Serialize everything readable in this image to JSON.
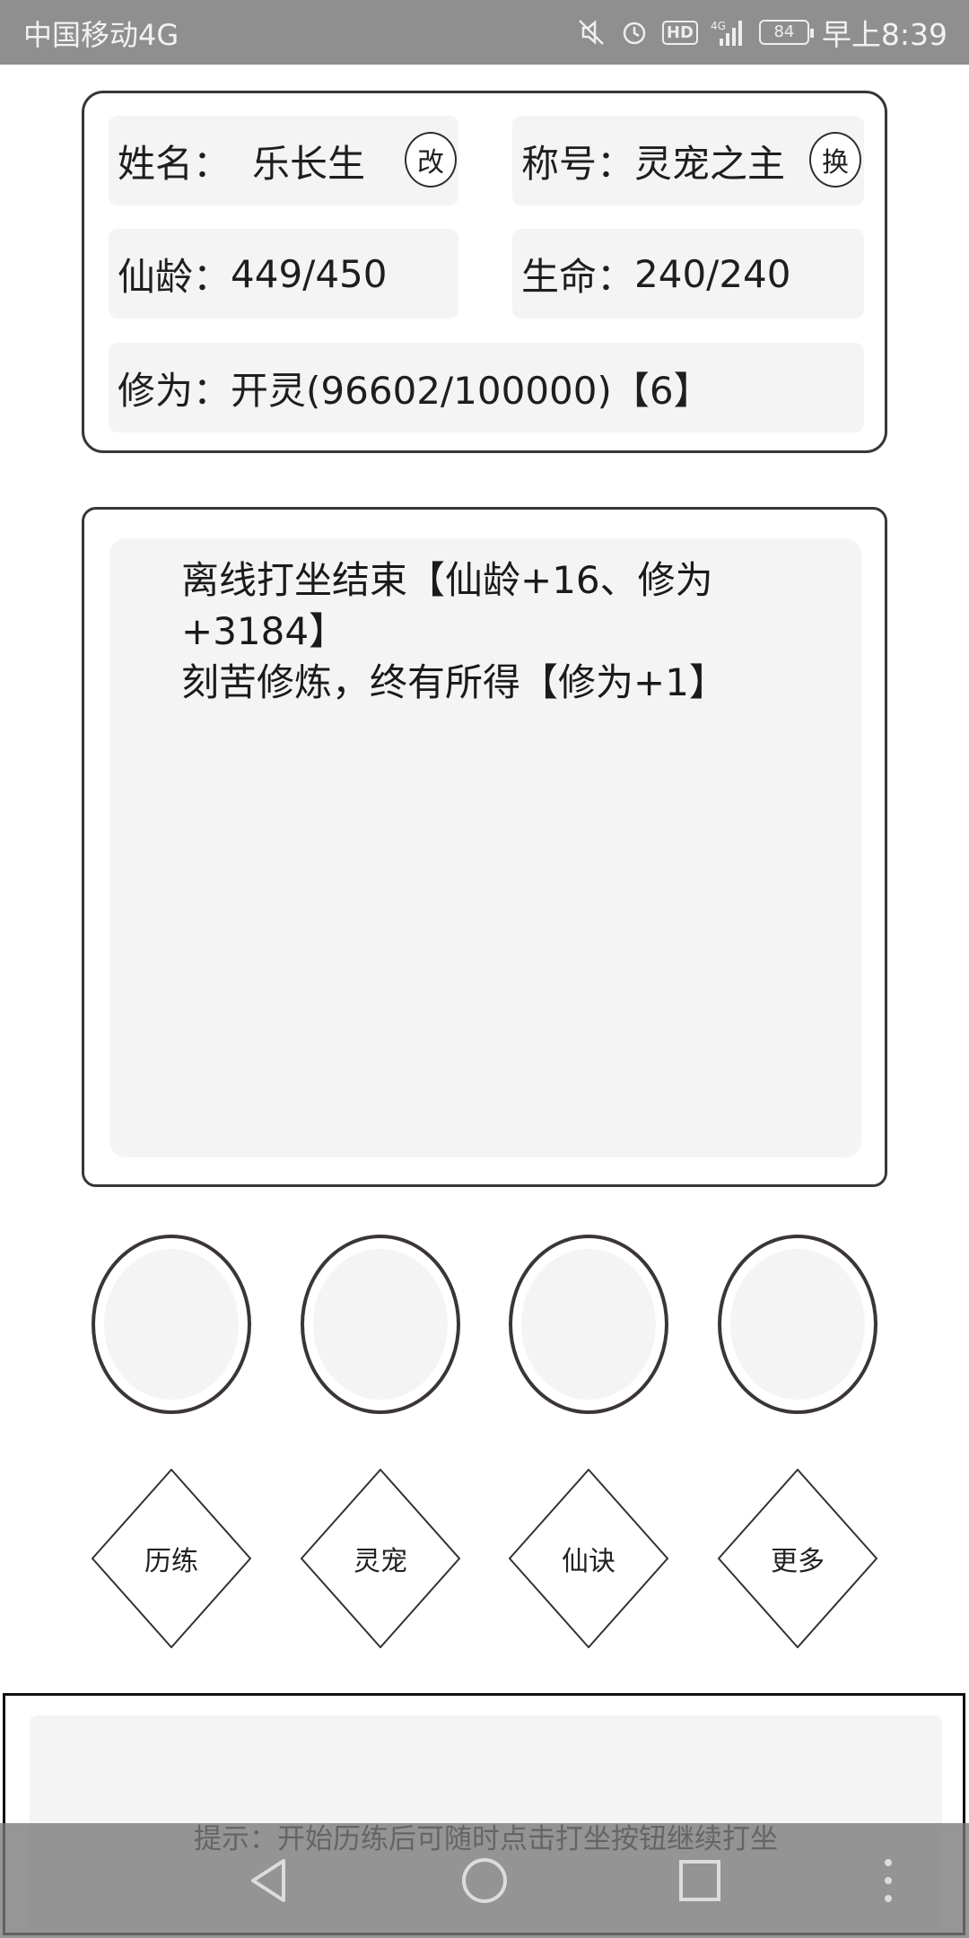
{
  "status_bar": {
    "carrier": "中国移动4G",
    "signal_label": "4G",
    "hd_label": "HD",
    "battery": "84",
    "time": "早上8:39",
    "icons": [
      "mute-icon",
      "alarm-icon",
      "hd-icon",
      "signal-icon",
      "battery-icon"
    ]
  },
  "profile": {
    "name_label": "姓名：",
    "name_value": "乐长生",
    "rename_button": "改",
    "title_label": "称号：",
    "title_value": "灵宠之主",
    "switch_title_button": "换",
    "age_label": "仙龄：",
    "age_value": "449/450",
    "life_label": "生命：",
    "life_value": "240/240",
    "cultivation_label": "修为：",
    "cultivation_value": "开灵(96602/100000)【6】"
  },
  "log": {
    "lines": [
      "离线打坐结束【仙龄+16、修为",
      "+3184】",
      "刻苦修炼，终有所得【修为+1】"
    ]
  },
  "actions": [
    {
      "label": "历练"
    },
    {
      "label": "灵宠"
    },
    {
      "label": "仙诀"
    },
    {
      "label": "更多"
    }
  ],
  "hint": {
    "text": "提示：开始历练后可随时点击打坐按钮继续打坐"
  },
  "nav": {
    "icons": [
      "back-icon",
      "home-icon",
      "recents-icon",
      "more-icon"
    ]
  },
  "colors": {
    "status_bar": "#8f8f8f",
    "panel": "#f4f4f4",
    "border": "#3a3636"
  }
}
